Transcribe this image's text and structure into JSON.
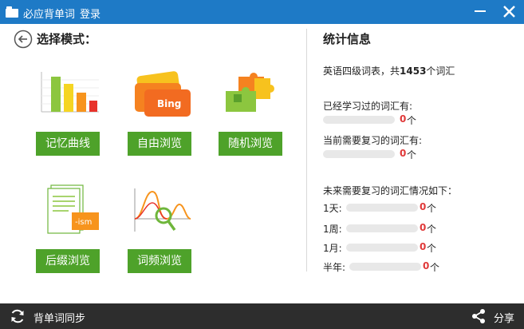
{
  "titlebar": {
    "app_title": "必应背单词",
    "login_label": "登录",
    "minimize_icon": "minimize-icon",
    "close_icon": "close-icon",
    "color": "#1e7ac6"
  },
  "modes": {
    "heading": "选择模式：",
    "back_icon": "back-arrow-icon",
    "button_color": "#4ea22a",
    "items": [
      {
        "label": "记忆曲线",
        "icon": "bar-chart-icon"
      },
      {
        "label": "自由浏览",
        "icon": "bing-cards-icon"
      },
      {
        "label": "随机浏览",
        "icon": "puzzle-pieces-icon"
      },
      {
        "label": "后缀浏览",
        "icon": "document-ism-icon"
      },
      {
        "label": "词频浏览",
        "icon": "frequency-chart-icon"
      }
    ]
  },
  "stats": {
    "title": "统计信息",
    "total_prefix": "英语四级词表，共",
    "total_count": "1453",
    "total_suffix": "个词汇",
    "learned_label": "已经学习过的词汇有:",
    "learned_count": "0",
    "review_label": "当前需要复习的词汇有:",
    "review_count": "0",
    "future_label": "未来需要复习的词汇情况如下：",
    "unit": "个",
    "accent_color": "#e03a3a",
    "future": [
      {
        "label": "1天:",
        "count": "0"
      },
      {
        "label": "1周:",
        "count": "0"
      },
      {
        "label": "1月:",
        "count": "0"
      },
      {
        "label": "半年:",
        "count": "0"
      }
    ]
  },
  "bottombar": {
    "sync_label": "背单词同步",
    "sync_icon": "sync-icon",
    "share_label": "分享",
    "share_icon": "share-icon"
  }
}
